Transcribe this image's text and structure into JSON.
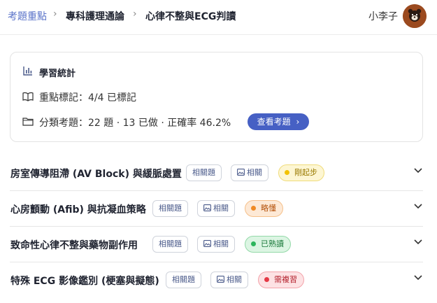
{
  "breadcrumb": {
    "home": "考題重點",
    "level2": "專科護理通論",
    "current": "心律不整與ECG判讀"
  },
  "user": {
    "name": "小李子"
  },
  "stats": {
    "title": "學習統計",
    "bookmarks": "重點標記：4/4 已標記",
    "practice": "分類考題：22 題 · 13 已做 · 正確率 46.2%",
    "view_button": "查看考題"
  },
  "topics": [
    {
      "title": "房室傳導阻滯 (AV Block) 與緩脈處置",
      "related_label": "相關題",
      "image_label": "相關",
      "status": "剛起步",
      "status_color": "#f2c200"
    },
    {
      "title": "心房顫動 (Afib) 與抗凝血策略",
      "related_label": "相關題",
      "image_label": "相關",
      "status": "略懂",
      "status_color": "#f08a24"
    },
    {
      "title": "致命性心律不整與藥物副作用",
      "related_label": "相關題",
      "image_label": "相關",
      "status": "已熟讀",
      "status_color": "#2db55d"
    },
    {
      "title": "特殊 ECG 影像鑑別 (梗塞與擬態)",
      "related_label": "相關題",
      "image_label": "相關",
      "status": "需複習",
      "status_color": "#e53945"
    }
  ],
  "colors": {
    "accent": "#4660c4",
    "link": "#5a73c9"
  }
}
